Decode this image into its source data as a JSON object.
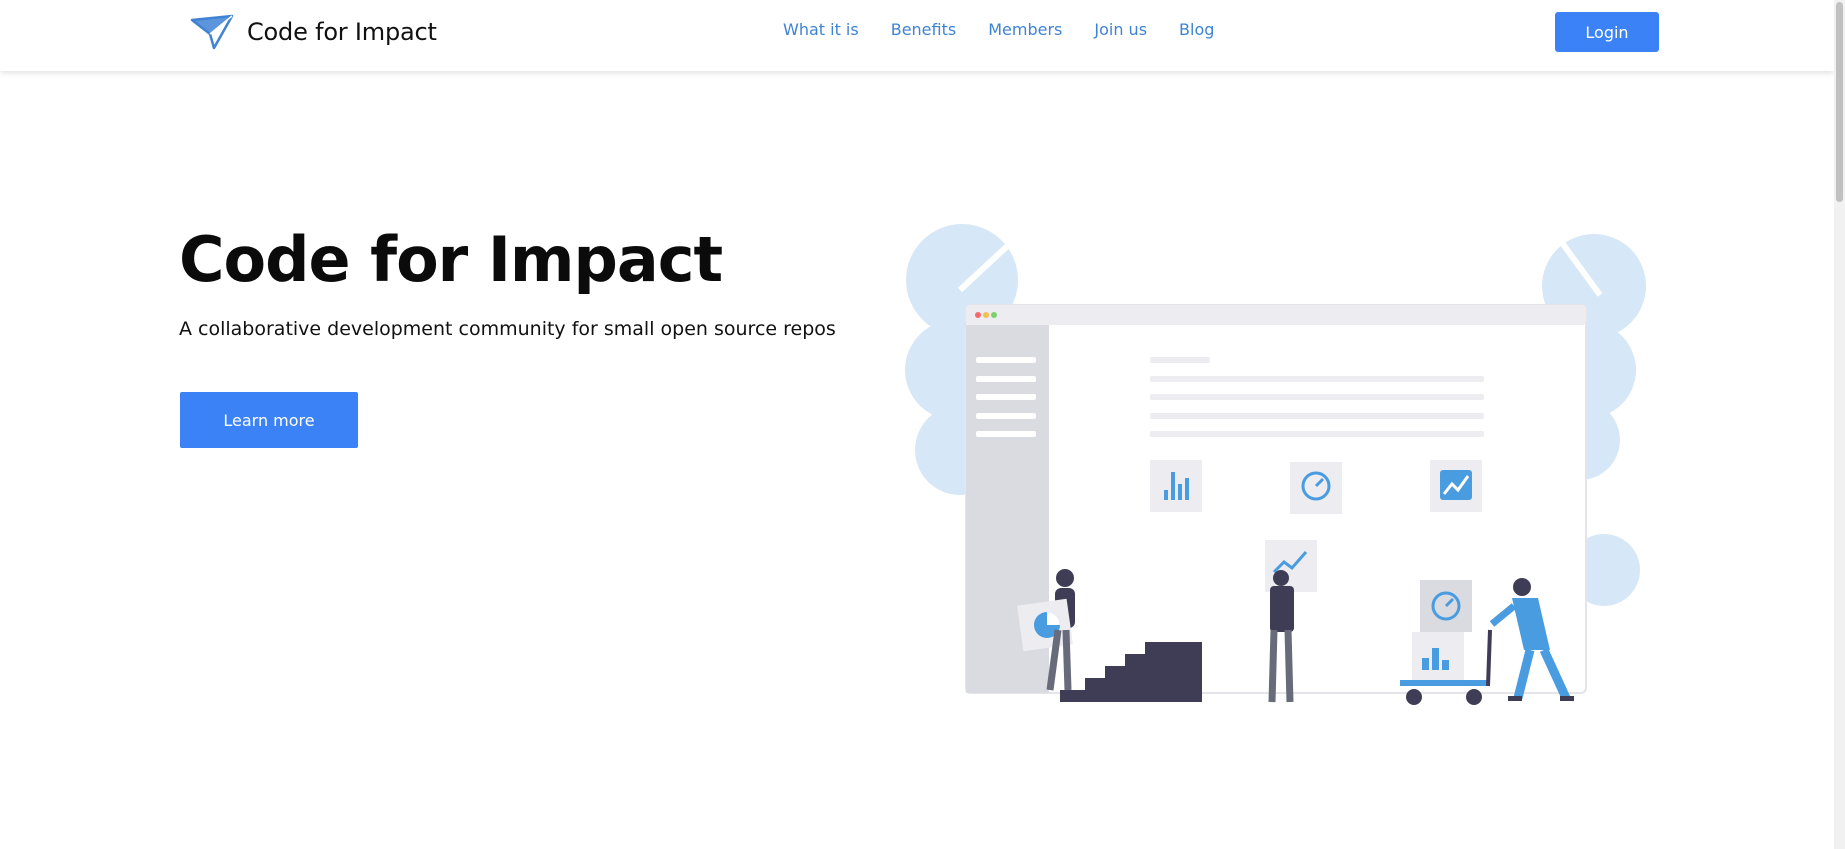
{
  "header": {
    "brand": "Code for Impact",
    "nav": [
      "What it is",
      "Benefits",
      "Members",
      "Join us",
      "Blog"
    ],
    "login": "Login"
  },
  "hero": {
    "title": "Code for Impact",
    "subtitle": "A collaborative development community for small open source repos",
    "cta": "Learn more"
  },
  "colors": {
    "accent": "#3b82f6",
    "link": "#3f83d5",
    "illustration_light": "#d6e7f7",
    "illustration_mid": "#4a9ce0",
    "dark": "#3f3d56"
  }
}
